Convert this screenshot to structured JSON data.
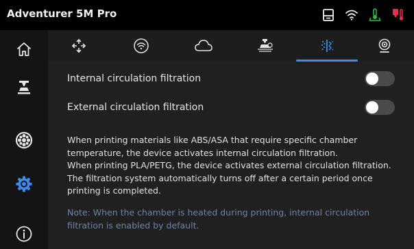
{
  "header": {
    "title": "Adventurer 5M Pro",
    "status_icons": [
      "printer-status-icon",
      "wifi-icon",
      "bed-temperature-icon",
      "nozzle-temperature-icon"
    ],
    "colors": {
      "bed_temp": "#2fb84a",
      "nozzle_temp": "#e0334a"
    }
  },
  "sidebar": {
    "items": [
      {
        "name": "home-icon",
        "active": false
      },
      {
        "name": "print-icon",
        "active": false
      },
      {
        "name": "filament-icon",
        "active": false
      },
      {
        "name": "settings-icon",
        "active": true
      },
      {
        "name": "info-icon",
        "active": false
      }
    ],
    "active_color": "#3c8cf0"
  },
  "tabs": {
    "items": [
      "move-icon",
      "wifi-icon",
      "cloud-icon",
      "print-bed-icon",
      "filtration-icon",
      "camera-icon"
    ],
    "active_index": 4
  },
  "settings": {
    "internal": {
      "label": "Internal circulation filtration",
      "enabled": false
    },
    "external": {
      "label": "External circulation filtration",
      "enabled": false
    }
  },
  "description": {
    "line1": "When printing materials like ABS/ASA that require specific chamber temperature, the device activates internal circulation filtration.",
    "line2": "When printing PLA/PETG, the device activates external circulation filtration.",
    "line3": "The filtration system automatically turns off after a certain period once printing is completed."
  },
  "note": "Note: When the chamber is heated during printing, internal circulation filtration is enabled by default."
}
